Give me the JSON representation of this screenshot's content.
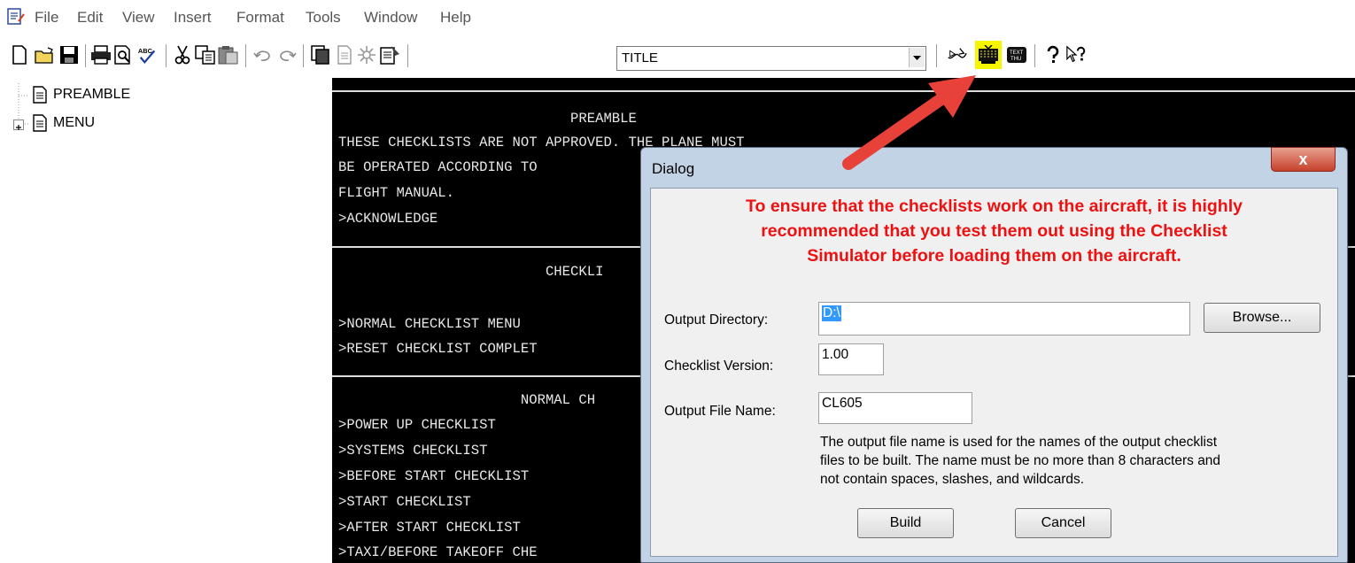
{
  "menu": [
    "File",
    "Edit",
    "View",
    "Insert",
    "Format",
    "Tools",
    "Window",
    "Help"
  ],
  "toolbar": {
    "icons": [
      "new-icon",
      "open-icon",
      "save-icon",
      "print-icon",
      "print-preview-icon",
      "spellcheck-icon",
      "cut-icon",
      "copy-icon",
      "paste-icon",
      "undo-icon",
      "redo-icon",
      "page-icon",
      "document-icon",
      "settings-icon",
      "properties-icon",
      "simulate-icon",
      "build-icon",
      "text-icon",
      "help-icon",
      "context-help-icon"
    ],
    "combo_value": "TITLE",
    "highlight_color": "#f5f500"
  },
  "tree": {
    "items": [
      "PREAMBLE",
      "MENU"
    ]
  },
  "terminal": {
    "lines": [
      "                            PREAMBLE",
      "THESE CHECKLISTS ARE NOT APPROVED. THE PLANE MUST",
      "BE OPERATED ACCORDING TO",
      "FLIGHT MANUAL.",
      ">ACKNOWLEDGE",
      "                         CHECKLI",
      ">NORMAL CHECKLIST MENU",
      ">RESET CHECKLIST COMPLET",
      "                      NORMAL CH",
      ">POWER UP CHECKLIST",
      ">SYSTEMS CHECKLIST",
      ">BEFORE START CHECKLIST",
      ">START CHECKLIST",
      ">AFTER START CHECKLIST",
      ">TAXI/BEFORE TAKEOFF CHE"
    ]
  },
  "dialog": {
    "title": "Dialog",
    "close_label": "x",
    "warning_lines": [
      "To ensure that the checklists work on the aircraft, it is highly",
      "recommended that you test them out using the Checklist",
      "Simulator before loading them on the aircraft."
    ],
    "output_directory_label": "Output Directory:",
    "output_directory_value": "D:\\",
    "browse_label": "Browse...",
    "checklist_version_label": "Checklist Version:",
    "checklist_version_value": "1.00",
    "output_file_name_label": "Output File Name:",
    "output_file_name_value": "CL605",
    "note_lines": [
      "The output file name is used for the names of the output checklist",
      "files to be built.  The name must be no more than 8 characters and",
      "not contain spaces, slashes, and wildcards."
    ],
    "build_label": "Build",
    "cancel_label": "Cancel",
    "warning_color": "#ee1111"
  },
  "annotation": {
    "arrow_color": "#e8413a"
  }
}
